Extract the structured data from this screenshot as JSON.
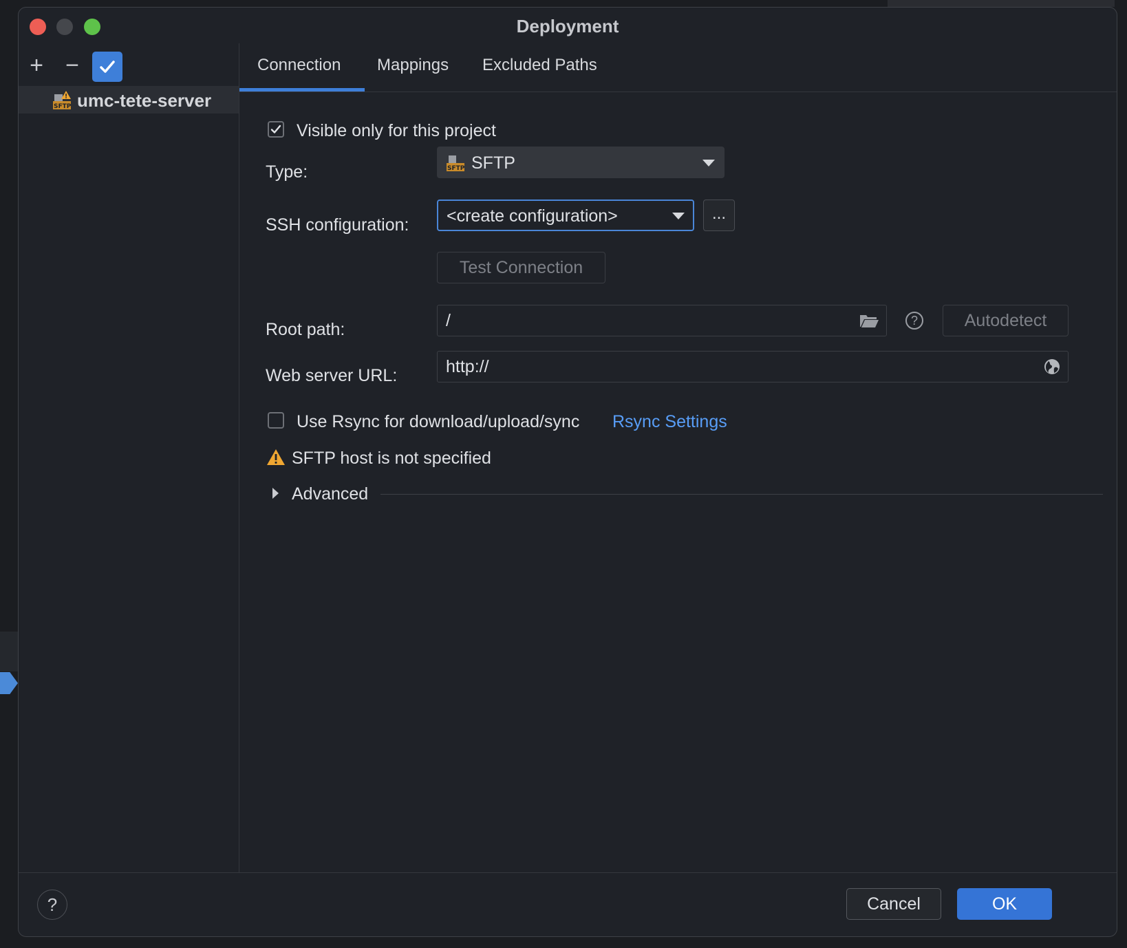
{
  "window": {
    "title": "Deployment"
  },
  "sidebar": {
    "toolbar": {
      "add_label": "+",
      "remove_label": "−"
    },
    "servers": [
      {
        "label": "umc-tete-server",
        "icon": "sftp-server-warning-icon"
      }
    ]
  },
  "tabs": [
    {
      "label": "Connection",
      "selected": true
    },
    {
      "label": "Mappings",
      "selected": false
    },
    {
      "label": "Excluded Paths",
      "selected": false
    }
  ],
  "connection": {
    "visible_only": {
      "label": "Visible only for this project",
      "checked": true
    },
    "type": {
      "label": "Type:",
      "value": "SFTP"
    },
    "ssh": {
      "label": "SSH configuration:",
      "value": "<create configuration>",
      "more_label": "..."
    },
    "test_connection_label": "Test Connection",
    "root_path": {
      "label": "Root path:",
      "value": "/",
      "autodetect_label": "Autodetect"
    },
    "web_server_url": {
      "label": "Web server URL:",
      "value": "http://"
    },
    "rsync": {
      "label": "Use Rsync for download/upload/sync",
      "checked": false,
      "settings_link": "Rsync Settings"
    },
    "warning": "SFTP host is not specified",
    "advanced_label": "Advanced"
  },
  "footer": {
    "help_label": "?",
    "cancel_label": "Cancel",
    "ok_label": "OK"
  },
  "colors": {
    "accent": "#3e7fd9",
    "link": "#589df6",
    "warning": "#f0a732",
    "background": "#1f2228"
  }
}
